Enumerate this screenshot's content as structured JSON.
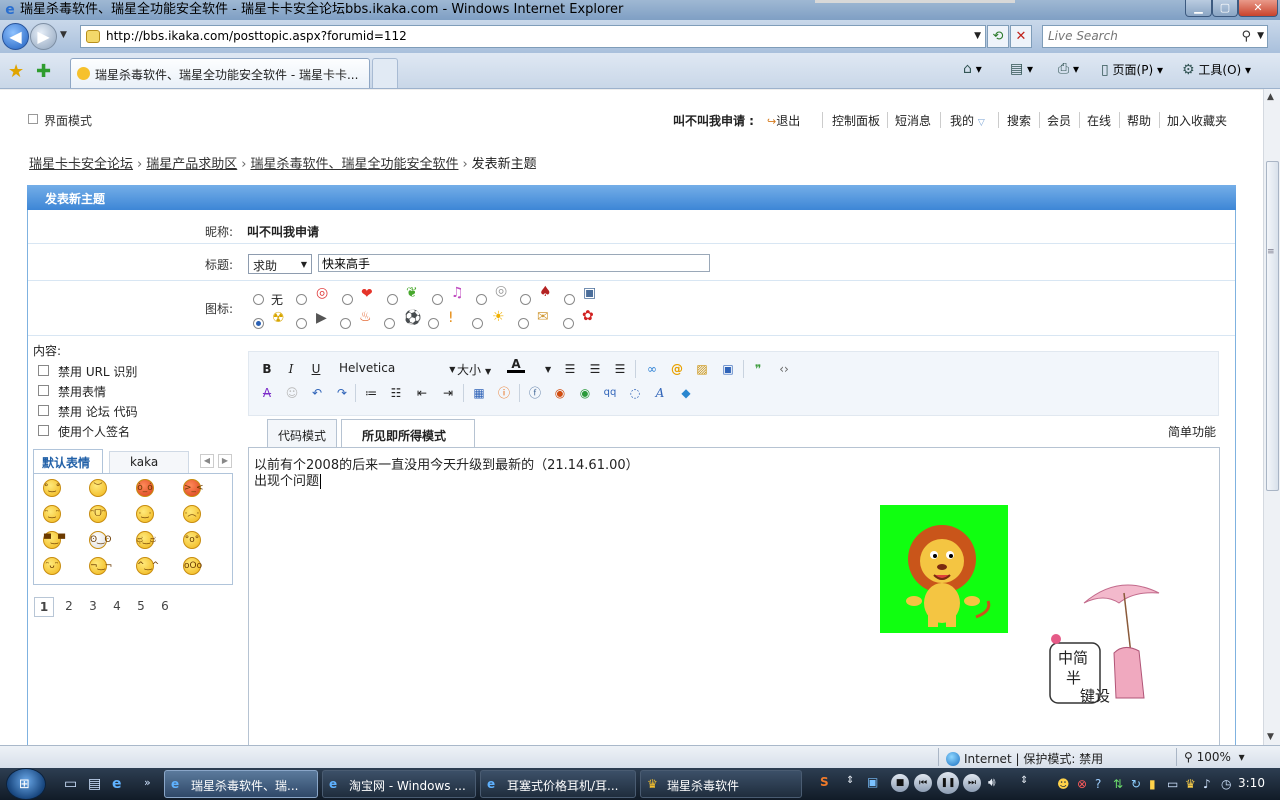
{
  "window": {
    "title": "瑞星杀毒软件、瑞星全功能安全软件 - 瑞星卡卡安全论坛bbs.ikaka.com - Windows Internet Explorer"
  },
  "browser": {
    "url": "http://bbs.ikaka.com/posttopic.aspx?forumid=112",
    "search_placeholder": "Live Search",
    "tab_title": "瑞星杀毒软件、瑞星全功能安全软件 - 瑞星卡卡...",
    "commands": {
      "page": "页面(P)",
      "tools": "工具(O)"
    }
  },
  "topbar": {
    "mode_label": "界面模式",
    "username": "叫不叫我申请 :",
    "logout": "退出",
    "links": [
      "控制面板",
      "短消息",
      "我的",
      "搜索",
      "会员",
      "在线",
      "帮助",
      "加入收藏夹"
    ]
  },
  "breadcrumb": {
    "items": [
      "瑞星卡卡安全论坛",
      "瑞星产品求助区",
      "瑞星杀毒软件、瑞星全功能安全软件"
    ],
    "current": "发表新主题"
  },
  "form": {
    "header": "发表新主题",
    "nickname_label": "昵称:",
    "nickname": "叫不叫我申请",
    "title_label": "标题:",
    "title_type": "求助",
    "title_value": "快来高手",
    "icon_label": "图标:",
    "icon_none": "无"
  },
  "options": {
    "content_label": "内容:",
    "checkboxes": [
      "禁用 URL 识别",
      "禁用表情",
      "禁用 论坛 代码",
      "使用个人签名"
    ]
  },
  "smilies": {
    "tabs": [
      "默认表情",
      "kaka"
    ],
    "pages": [
      "1",
      "2",
      "3",
      "4",
      "5",
      "6"
    ]
  },
  "editor": {
    "font": "Helvetica",
    "size": "大小",
    "tab_code": "代码模式",
    "tab_wysiwyg": "所见即所得模式",
    "simple_func": "简单功能",
    "line1": "以前有个2008的后来一直没用今天升级到最新的（21.14.61.00）",
    "line2": "出现个问题",
    "sticker_text": [
      "中简",
      "半",
      "键设"
    ]
  },
  "statusbar": {
    "zone": "Internet | 保护模式: 禁用",
    "zoom": "100%"
  },
  "taskbar": {
    "tasks": [
      "瑞星杀毒软件、瑞...",
      "淘宝网 - Windows ...",
      "耳塞式价格耳机/耳...",
      "瑞星杀毒软件"
    ],
    "clock": "3:10"
  },
  "colors": {
    "accent": "#3d86d6",
    "border": "#7fb2e0",
    "lion_bg": "#10ff10"
  }
}
